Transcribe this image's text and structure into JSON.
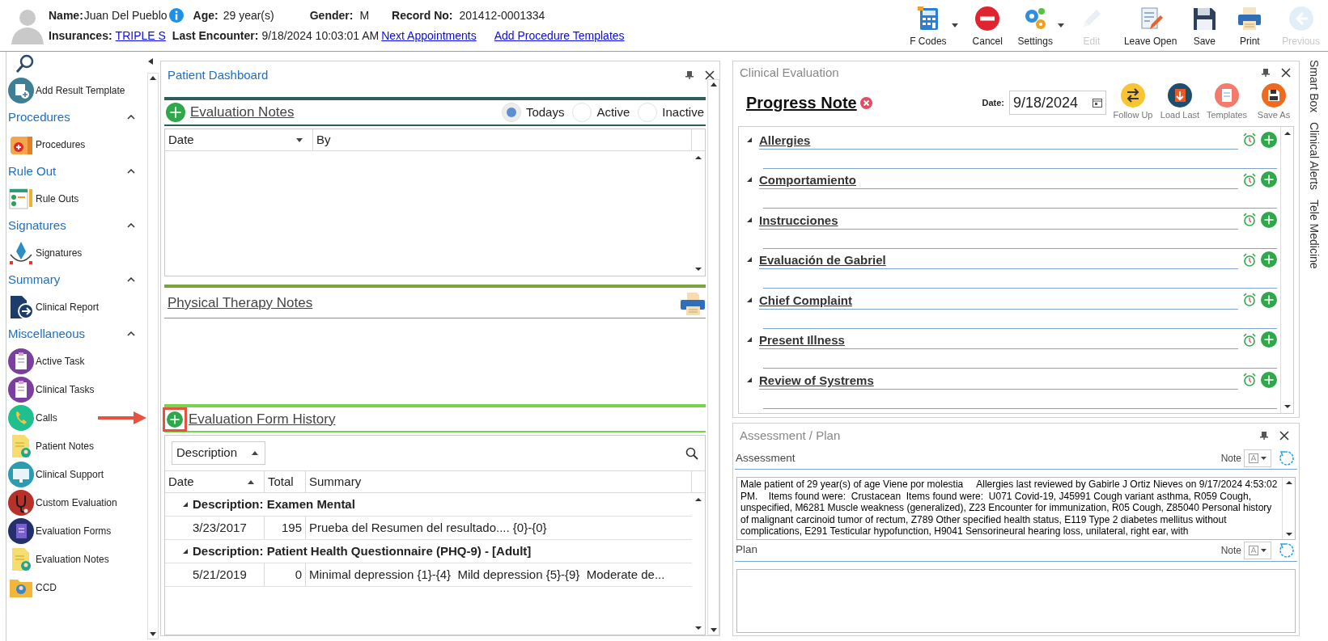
{
  "patient": {
    "name": {
      "label": "Name:",
      "value": "Juan Del Pueblo"
    },
    "age": {
      "label": "Age:",
      "value": "29 year(s)"
    },
    "gender": {
      "label": "Gender:",
      "value": "M"
    },
    "record_no": {
      "label": "Record No:",
      "value": "201412-0001334"
    },
    "insurances": {
      "label": "Insurances:",
      "value": "TRIPLE S"
    },
    "last_encounter": {
      "label": "Last Encounter:",
      "value": "9/18/2024 10:03:01 AM"
    },
    "links": [
      "Next Appointments",
      "Add Procedure Templates"
    ]
  },
  "toolbar": [
    {
      "label": "F Codes",
      "disabled": false,
      "dropdown": true
    },
    {
      "label": "Cancel",
      "disabled": false,
      "dropdown": false
    },
    {
      "label": "Settings",
      "disabled": false,
      "dropdown": true
    },
    {
      "label": "Edit",
      "disabled": true,
      "dropdown": false
    },
    {
      "label": "Leave Open",
      "disabled": false,
      "dropdown": false
    },
    {
      "label": "Save",
      "disabled": false,
      "dropdown": false
    },
    {
      "label": "Print",
      "disabled": false,
      "dropdown": false
    },
    {
      "label": "Previous",
      "disabled": true,
      "dropdown": false
    }
  ],
  "sidebar": {
    "items": [
      {
        "label": "Add Result Template"
      }
    ],
    "groups": [
      {
        "title": "Procedures",
        "expanded": true,
        "items": [
          {
            "label": "Procedures"
          }
        ]
      },
      {
        "title": "Rule Out",
        "expanded": true,
        "items": [
          {
            "label": "Rule Outs"
          }
        ]
      },
      {
        "title": "Signatures",
        "expanded": true,
        "items": [
          {
            "label": "Signatures"
          }
        ]
      },
      {
        "title": "Summary",
        "expanded": true,
        "items": [
          {
            "label": "Clinical Report"
          }
        ]
      },
      {
        "title": "Miscellaneous",
        "expanded": true,
        "items": [
          {
            "label": "Active Task"
          },
          {
            "label": "Clinical Tasks"
          },
          {
            "label": "Calls"
          },
          {
            "label": "Patient Notes"
          },
          {
            "label": "Clinical Support"
          },
          {
            "label": "Custom Evaluation"
          },
          {
            "label": "Evaluation Forms"
          },
          {
            "label": "Evaluation Notes"
          },
          {
            "label": "CCD"
          }
        ]
      }
    ]
  },
  "dashboard": {
    "title": "Patient Dashboard",
    "evaluation_notes": {
      "title": "Evaluation Notes",
      "filters": [
        {
          "label": "Todays",
          "selected": true
        },
        {
          "label": "Active",
          "selected": false
        },
        {
          "label": "Inactive",
          "selected": false
        }
      ],
      "columns": [
        "Date",
        "By"
      ]
    },
    "physical_therapy_notes": {
      "title": "Physical Therapy Notes"
    },
    "evaluation_form_history": {
      "title": "Evaluation Form History",
      "group_by": "Description",
      "columns": [
        "Date",
        "Total",
        "Summary"
      ],
      "groups": [
        {
          "title": "Description: Examen Mental",
          "expanded": true,
          "rows": [
            {
              "date": "3/23/2017",
              "total": "195",
              "summary": "Prueba del Resumen del resultado.... {0}-{0}"
            }
          ]
        },
        {
          "title": "Description: Patient Health Questionnaire (PHQ-9) - [Adult]",
          "expanded": true,
          "rows": [
            {
              "date": "5/21/2019",
              "total": "0",
              "summary": "Minimal depression {1}-{4}  Mild depression {5}-{9}  Moderate de..."
            }
          ]
        }
      ]
    }
  },
  "clinical_evaluation": {
    "title": "Clinical Evaluation",
    "note_title": "Progress Note",
    "date_label": "Date:",
    "date": "9/18/2024",
    "actions": [
      "Follow Up",
      "Load Last",
      "Templates",
      "Save As"
    ],
    "sections": [
      {
        "title": "Allergies",
        "expanded": true
      },
      {
        "title": "Comportamiento",
        "expanded": true
      },
      {
        "title": "Instrucciones",
        "expanded": true
      },
      {
        "title": "Evaluación de Gabriel",
        "expanded": true
      },
      {
        "title": "Chief Complaint",
        "expanded": true
      },
      {
        "title": "Present Illness",
        "expanded": true
      },
      {
        "title": "Review of Systrems",
        "expanded": true
      }
    ]
  },
  "assessment_plan": {
    "title": "Assessment / Plan",
    "fields": [
      {
        "label": "Assessment",
        "note_label": "Note",
        "text": "Male patient of 29 year(s) of age Viene por molestia     Allergies last reviewed by Gabirle J Ortiz Nieves on 9/17/2024 4:53:02 PM.    Items found were:  Crustacean  Items found were:  U071 Covid-19, J45991 Cough variant asthma, R059 Cough, unspecified, M6281 Muscle weakness (generalized), Z23 Encounter for immunization, R05 Cough, Z85040 Personal history of malignant carcinoid tumor of rectum, Z789 Other specified health status, E119 Type 2 diabetes mellitus without complications, E291 Testicular hypofunction, H9041 Sensorineural hearing loss, unilateral, right ear, with"
      },
      {
        "label": "Plan",
        "note_label": "Note"
      }
    ]
  },
  "side_tabs": [
    "Smart Box",
    "Clinical Alerts",
    "Tele Medicine"
  ]
}
